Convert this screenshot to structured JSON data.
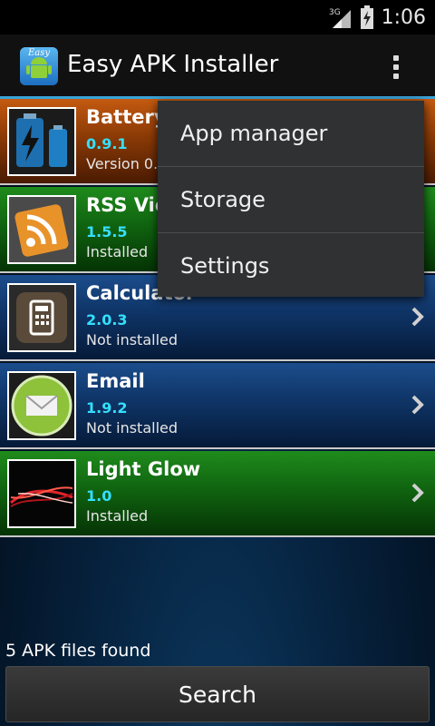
{
  "status_bar": {
    "network": "3G",
    "time": "1:06"
  },
  "action_bar": {
    "title": "Easy APK Installer",
    "icon_text": "Easy"
  },
  "apps": [
    {
      "name": "Battery",
      "version": "0.9.1",
      "status": "Version 0.8",
      "color": "#c45a10"
    },
    {
      "name": "RSS Vie",
      "version": "1.5.5",
      "status": "Installed",
      "color": "#1f8b1c"
    },
    {
      "name": "Calculator",
      "version": "2.0.3",
      "status": "Not installed",
      "color": "#1b4d8c"
    },
    {
      "name": "Email",
      "version": "1.9.2",
      "status": "Not installed",
      "color": "#1b4d8c"
    },
    {
      "name": "Light Glow",
      "version": "1.0",
      "status": "Installed",
      "color": "#1f8b1c"
    }
  ],
  "footer": {
    "found_text": "5 APK files found",
    "search_label": "Search"
  },
  "overflow_menu": {
    "items": [
      "App manager",
      "Storage",
      "Settings"
    ]
  },
  "colors": {
    "accent": "#3aa3d9",
    "version_text": "#33e0ff"
  }
}
